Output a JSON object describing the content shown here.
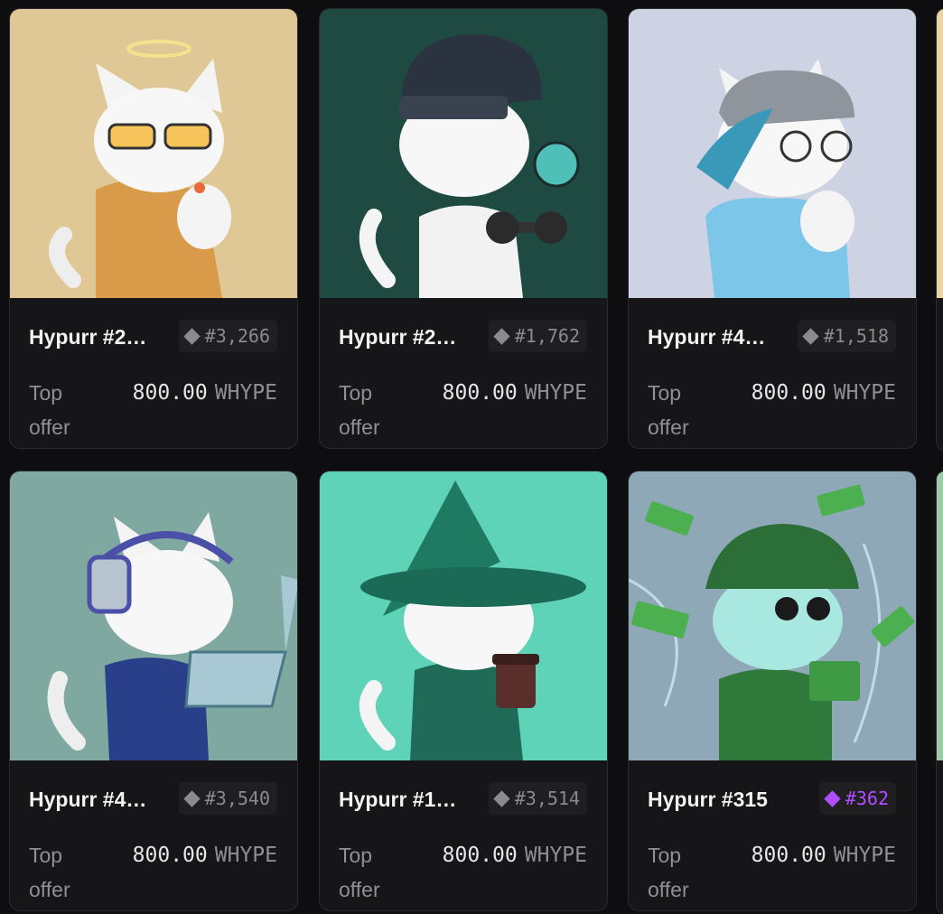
{
  "cards": [
    {
      "title": "Hypurr #2…",
      "rank": "#3,266",
      "rank_color": "#8a8a8f",
      "offer_label": "Top offer",
      "price": "800.00",
      "currency": "WHYPE",
      "bg": "#e0c796"
    },
    {
      "title": "Hypurr #2…",
      "rank": "#1,762",
      "rank_color": "#8a8a8f",
      "offer_label": "Top offer",
      "price": "800.00",
      "currency": "WHYPE",
      "bg": "#1e4a42"
    },
    {
      "title": "Hypurr #4…",
      "rank": "#1,518",
      "rank_color": "#8a8a8f",
      "offer_label": "Top offer",
      "price": "800.00",
      "currency": "WHYPE",
      "bg": "#cdd3e3"
    },
    {
      "title": "Hypurr #4…",
      "rank": "#3,540",
      "rank_color": "#8a8a8f",
      "offer_label": "Top offer",
      "price": "800.00",
      "currency": "WHYPE",
      "bg": "#7fa8a0"
    },
    {
      "title": "Hypurr #1…",
      "rank": "#3,514",
      "rank_color": "#8a8a8f",
      "offer_label": "Top offer",
      "price": "800.00",
      "currency": "WHYPE",
      "bg": "#5fd3b8"
    },
    {
      "title": "Hypurr #315",
      "rank": "#362",
      "rank_color": "#b04dff",
      "offer_label": "Top offer",
      "price": "800.00",
      "currency": "WHYPE",
      "bg": "#8fa8b8"
    }
  ]
}
